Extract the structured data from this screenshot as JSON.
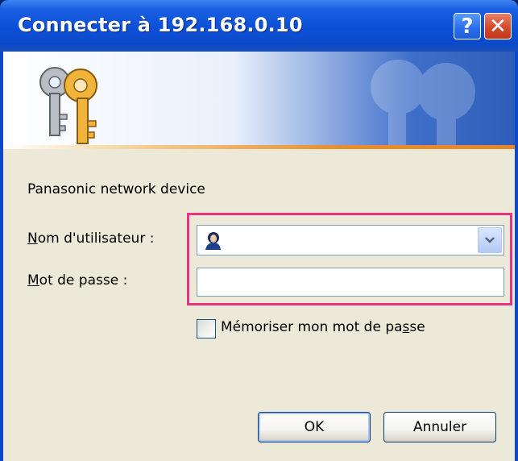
{
  "window": {
    "title": "Connecter à 192.168.0.10",
    "help_glyph": "?",
    "close_glyph": "✕"
  },
  "banner": {
    "icon": "keys-icon"
  },
  "form": {
    "device_name": "Panasonic network device",
    "username_label_hotkey": "N",
    "username_label_rest": "om d'utilisateur :",
    "username_value": "",
    "password_label_hotkey": "M",
    "password_label_rest": "ot de passe :",
    "password_value": "",
    "remember_label_pre": "Mémoriser mon mot de pa",
    "remember_label_hotkey": "s",
    "remember_label_post": "se",
    "remember_checked": false
  },
  "buttons": {
    "ok_label": "OK",
    "cancel_label": "Annuler"
  },
  "colors": {
    "titlebar": "#0b4fd6",
    "highlight": "#e6357e",
    "dialog_bg": "#ece9d8"
  }
}
